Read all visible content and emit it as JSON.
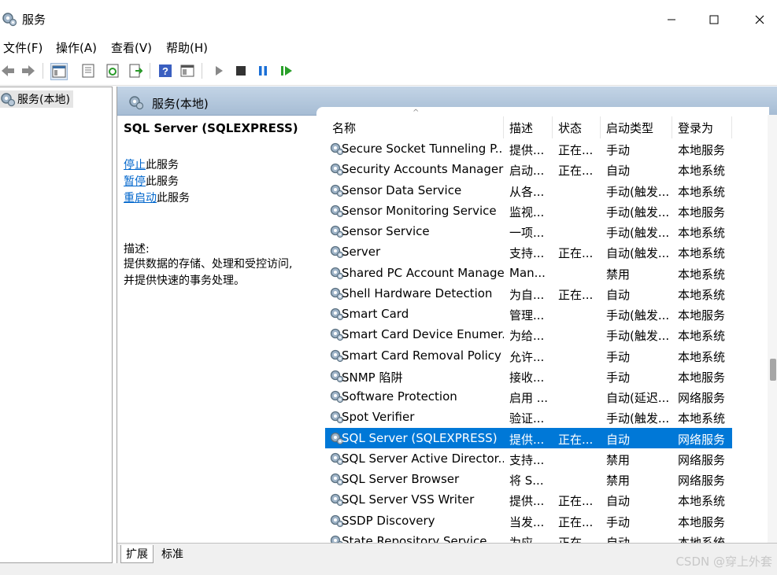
{
  "window": {
    "title": "服务"
  },
  "menu": [
    "文件(F)",
    "操作(A)",
    "查看(V)",
    "帮助(H)"
  ],
  "tree": {
    "root": "服务(本地)"
  },
  "panel": {
    "header": "服务(本地)"
  },
  "details": {
    "service_name": "SQL Server (SQLEXPRESS)",
    "actions": [
      {
        "link": "停止",
        "rest": "此服务"
      },
      {
        "link": "暂停",
        "rest": "此服务"
      },
      {
        "link": "重启动",
        "rest": "此服务"
      }
    ],
    "description_label": "描述:",
    "description_line1": "提供数据的存储、处理和受控访问,",
    "description_line2": "并提供快速的事务处理。"
  },
  "table": {
    "columns": [
      "名称",
      "描述",
      "状态",
      "启动类型",
      "登录为"
    ],
    "sort_indicator": "^",
    "rows": [
      [
        "Secure Socket Tunneling P...",
        "提供...",
        "正在...",
        "手动",
        "本地服务"
      ],
      [
        "Security Accounts Manager",
        "启动...",
        "正在...",
        "自动",
        "本地系统"
      ],
      [
        "Sensor Data Service",
        "从各...",
        "",
        "手动(触发...",
        "本地系统"
      ],
      [
        "Sensor Monitoring Service",
        "监视...",
        "",
        "手动(触发...",
        "本地服务"
      ],
      [
        "Sensor Service",
        "一项...",
        "",
        "手动(触发...",
        "本地系统"
      ],
      [
        "Server",
        "支持...",
        "正在...",
        "自动(触发...",
        "本地系统"
      ],
      [
        "Shared PC Account Manager",
        "Man...",
        "",
        "禁用",
        "本地系统"
      ],
      [
        "Shell Hardware Detection",
        "为自...",
        "正在...",
        "自动",
        "本地系统"
      ],
      [
        "Smart Card",
        "管理...",
        "",
        "手动(触发...",
        "本地服务"
      ],
      [
        "Smart Card Device Enumer...",
        "为给...",
        "",
        "手动(触发...",
        "本地系统"
      ],
      [
        "Smart Card Removal Policy",
        "允许...",
        "",
        "手动",
        "本地系统"
      ],
      [
        "SNMP 陷阱",
        "接收...",
        "",
        "手动",
        "本地服务"
      ],
      [
        "Software Protection",
        "启用 ...",
        "",
        "自动(延迟...",
        "网络服务"
      ],
      [
        "Spot Verifier",
        "验证...",
        "",
        "手动(触发...",
        "本地系统"
      ],
      [
        "SQL Server (SQLEXPRESS)",
        "提供...",
        "正在...",
        "自动",
        "网络服务"
      ],
      [
        "SQL Server Active Director...",
        "支持...",
        "",
        "禁用",
        "网络服务"
      ],
      [
        "SQL Server Browser",
        "将 S...",
        "",
        "禁用",
        "网络服务"
      ],
      [
        "SQL Server VSS Writer",
        "提供...",
        "正在...",
        "自动",
        "本地系统"
      ],
      [
        "SSDP Discovery",
        "当发...",
        "正在...",
        "手动",
        "本地服务"
      ],
      [
        "State Repository Service",
        "为应...",
        "正在...",
        "自动",
        "本地系统"
      ]
    ],
    "selected_index": 14
  },
  "tabs": [
    "扩展",
    "标准"
  ],
  "watermark": "CSDN @穿上外套",
  "colors": {
    "selection": "#0078d7",
    "link": "#0066cc",
    "header": "#b4c8de"
  },
  "icons": {
    "back": "arrow-left-icon",
    "forward": "arrow-right-icon",
    "show-tree": "console-tree-icon",
    "properties": "properties-icon",
    "refresh": "refresh-icon",
    "export": "export-list-icon",
    "help": "help-icon",
    "view": "view-icon",
    "start": "play-icon",
    "stop": "stop-icon",
    "pause": "pause-icon",
    "restart": "restart-icon"
  }
}
